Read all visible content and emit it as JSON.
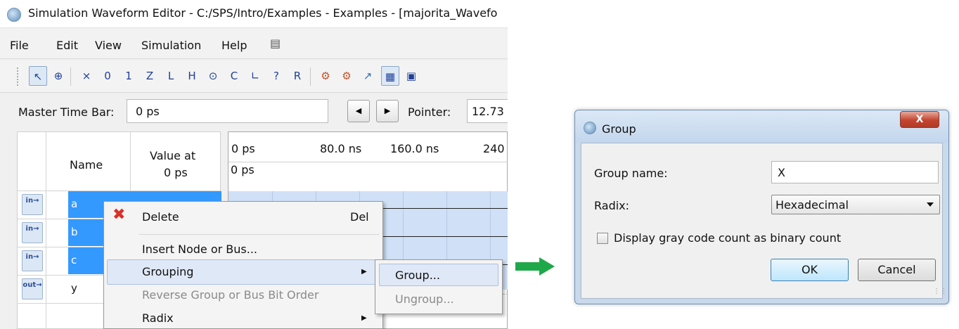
{
  "editor": {
    "title": "Simulation Waveform Editor - C:/SPS/Intro/Examples - Examples - [majorita_Wavefo",
    "menu": [
      "File",
      "Edit",
      "View",
      "Simulation",
      "Help"
    ],
    "master_time_bar_label": "Master Time Bar:",
    "master_time_bar_value": "0 ps",
    "pointer_label": "Pointer:",
    "pointer_value": "12.73",
    "table": {
      "name_header": "Name",
      "value_header_line1": "Value at",
      "value_header_line2": "0 ps",
      "rows": [
        {
          "icon": "input-pin-icon",
          "icon_text": "in",
          "name": "a",
          "selected": true
        },
        {
          "icon": "input-pin-icon",
          "icon_text": "in",
          "name": "b",
          "selected": true
        },
        {
          "icon": "input-pin-icon",
          "icon_text": "in",
          "name": "c",
          "selected": true
        },
        {
          "icon": "output-pin-icon",
          "icon_text": "out",
          "name": "y",
          "selected": false
        }
      ]
    },
    "waveform": {
      "ticks": [
        "0 ps",
        "80.0 ns",
        "160.0 ns",
        "240"
      ],
      "cursor_label": "0 ps"
    },
    "context_menu": {
      "delete_label": "Delete",
      "delete_shortcut": "Del",
      "insert_label": "Insert Node or Bus...",
      "grouping_label": "Grouping",
      "reverse_label": "Reverse Group or Bus Bit Order",
      "radix_label": "Radix"
    },
    "submenu": {
      "group_label": "Group...",
      "ungroup_label": "Ungroup..."
    }
  },
  "dialog": {
    "title": "Group",
    "close_label": "X",
    "group_name_label": "Group name:",
    "group_name_value": "X",
    "radix_label": "Radix:",
    "radix_value": "Hexadecimal",
    "gray_code_label": "Display gray code count as binary count",
    "gray_code_checked": false,
    "ok_label": "OK",
    "cancel_label": "Cancel"
  },
  "colors": {
    "selection": "#3399ff",
    "waveform_fill": "#cfe0f7",
    "arrow": "#1fa84a",
    "delete_icon": "#d9302a"
  }
}
